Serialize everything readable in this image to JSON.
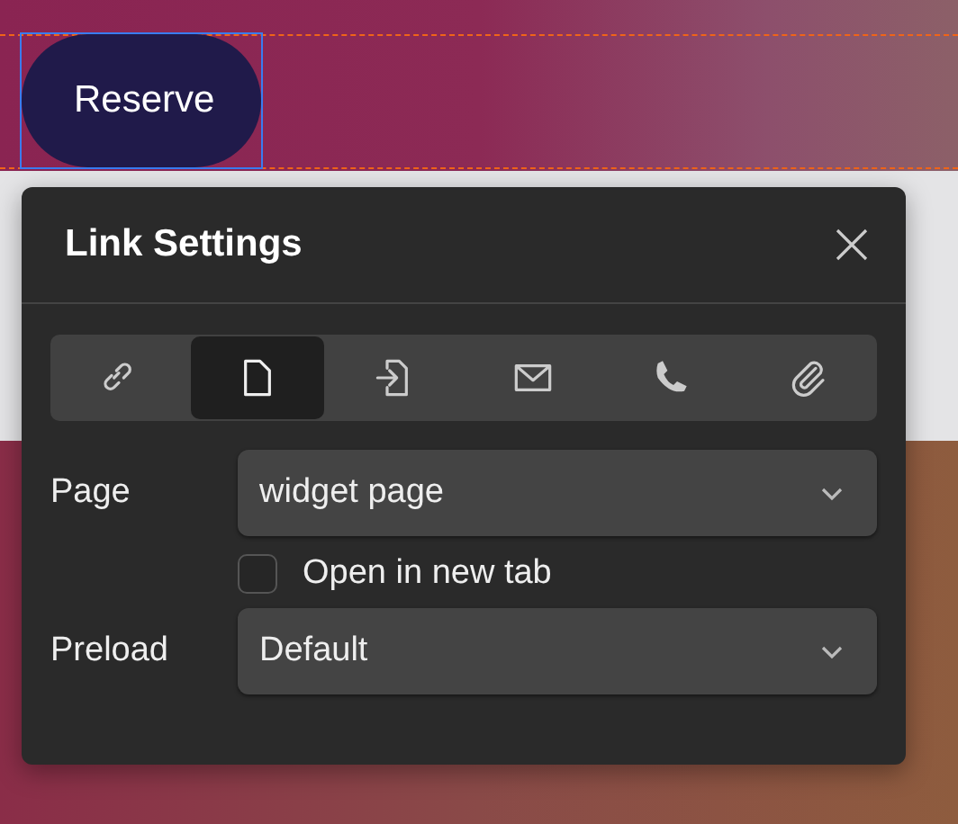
{
  "button": {
    "label": "Reserve"
  },
  "dialog": {
    "title": "Link Settings",
    "tabs": [
      {
        "kind": "url",
        "selected": false
      },
      {
        "kind": "page",
        "selected": true
      },
      {
        "kind": "section",
        "selected": false
      },
      {
        "kind": "email",
        "selected": false
      },
      {
        "kind": "phone",
        "selected": false
      },
      {
        "kind": "attachment",
        "selected": false
      }
    ],
    "page_field": {
      "label": "Page",
      "value": "widget page"
    },
    "new_tab": {
      "label": "Open in new tab",
      "checked": false
    },
    "preload_field": {
      "label": "Preload",
      "value": "Default"
    }
  }
}
